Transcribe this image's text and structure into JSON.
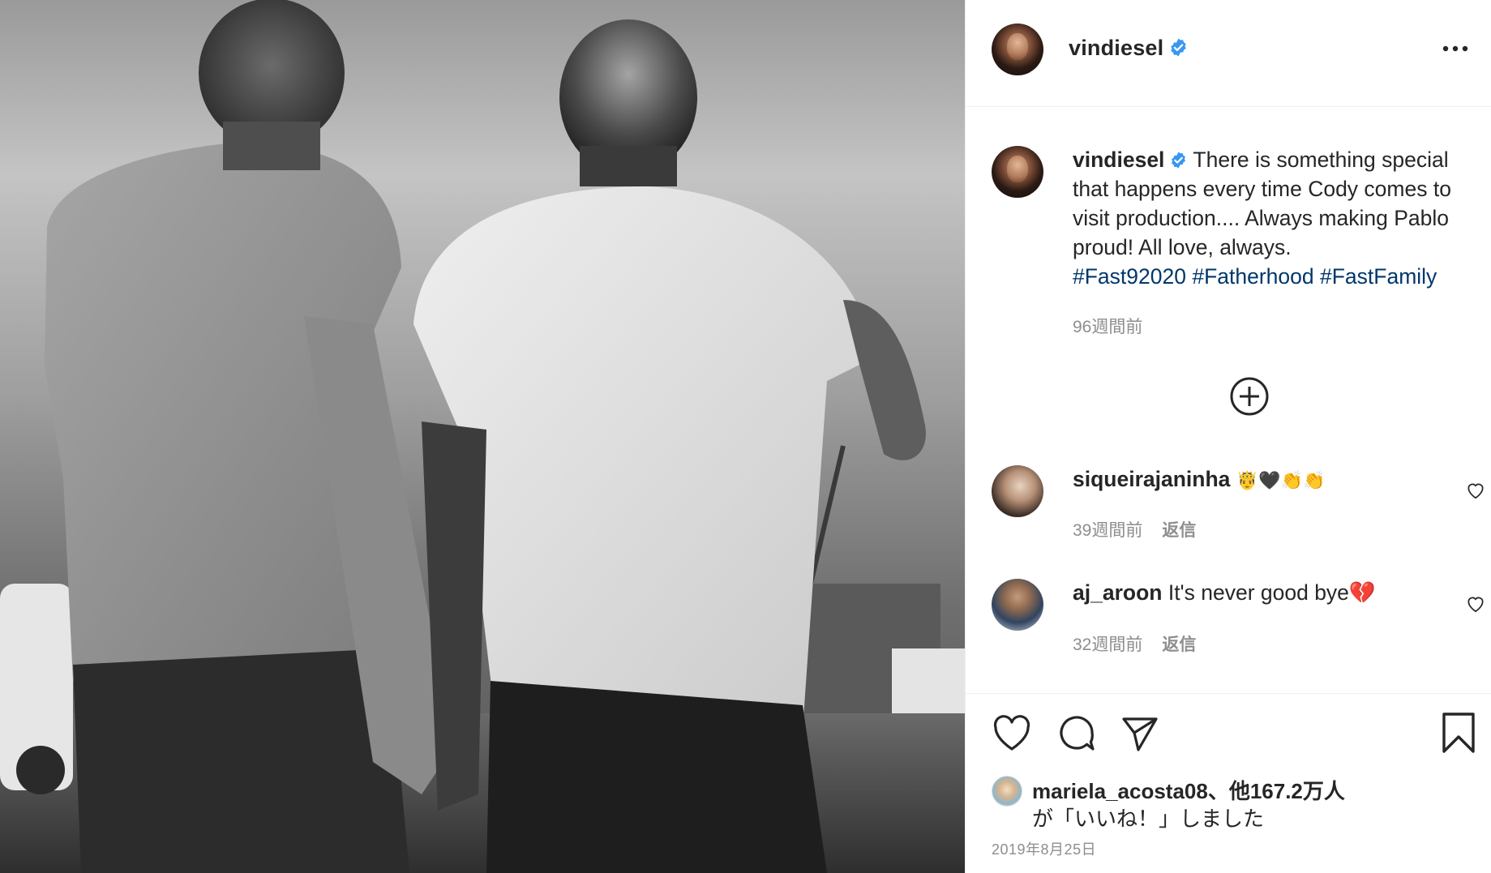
{
  "post": {
    "author": "vindiesel",
    "verified": true,
    "photo_alt": "Two men seen from behind walking across a lot"
  },
  "caption": {
    "username": "vindiesel",
    "text": "There is something special that happens every time Cody comes to visit production.... Always making Pablo proud! All love, always.",
    "hashtags": [
      "#Fast92020",
      "#Fatherhood",
      "#FastFamily"
    ],
    "time_ago": "96週間前"
  },
  "comments": [
    {
      "username": "siqueirajaninha",
      "text": "🤴🖤👏👏",
      "time_ago": "39週間前",
      "reply_label": "返信"
    },
    {
      "username": "aj_aroon",
      "text": "It's never good bye💔",
      "time_ago": "32週間前",
      "reply_label": "返信"
    }
  ],
  "likes": {
    "line1": "mariela_acosta08、他167.2万人",
    "line2": "が「いいね！」しました"
  },
  "date": "2019年8月25日",
  "icons": {
    "more": "more-horizontal-icon",
    "load_more": "plus-circle-icon",
    "like": "heart-icon",
    "comment": "comment-bubble-icon",
    "share": "paper-plane-icon",
    "save": "bookmark-icon"
  },
  "colors": {
    "text": "#262626",
    "muted": "#8e8e8e",
    "hashtag": "#00376b",
    "verified": "#3897f0",
    "border": "#efefef"
  }
}
